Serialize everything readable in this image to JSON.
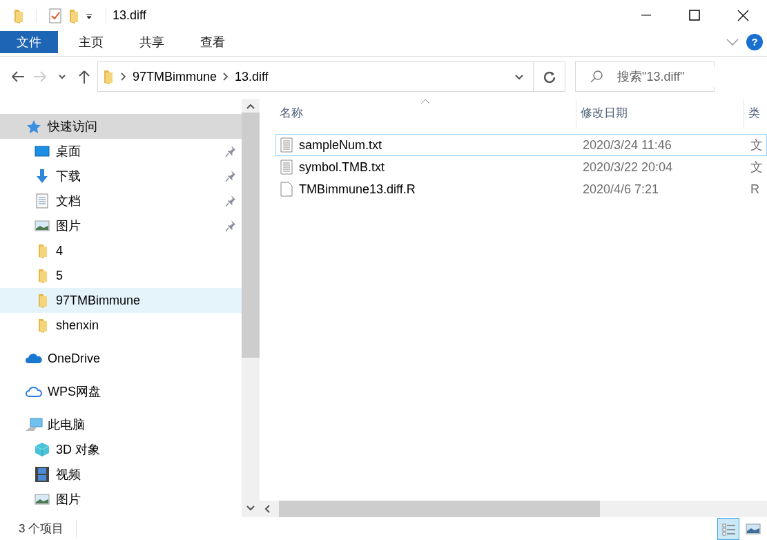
{
  "window": {
    "title": "13.diff"
  },
  "ribbon_tabs": [
    {
      "label": "文件",
      "selected": true
    },
    {
      "label": "主页",
      "selected": false
    },
    {
      "label": "共享",
      "selected": false
    },
    {
      "label": "查看",
      "selected": false
    }
  ],
  "help_button": {
    "label": "?"
  },
  "address_bar": {
    "path": [
      "97TMBimmune",
      "13.diff"
    ]
  },
  "search": {
    "placeholder": "搜索\"13.diff\""
  },
  "sidebar": {
    "items": [
      {
        "label": "快速访问",
        "kind": "star",
        "selected": false,
        "hovered": true,
        "pinned": false,
        "children": [
          {
            "label": "桌面",
            "kind": "desktop",
            "selected": false,
            "hovered": false,
            "pinned": true
          },
          {
            "label": "下载",
            "kind": "download",
            "selected": false,
            "hovered": false,
            "pinned": true
          },
          {
            "label": "文档",
            "kind": "document",
            "selected": false,
            "hovered": false,
            "pinned": true
          },
          {
            "label": "图片",
            "kind": "picture",
            "selected": false,
            "hovered": false,
            "pinned": true
          },
          {
            "label": "4",
            "kind": "folder",
            "selected": false,
            "hovered": false,
            "pinned": false
          },
          {
            "label": "5",
            "kind": "folder",
            "selected": false,
            "hovered": false,
            "pinned": false
          },
          {
            "label": "97TMBimmune",
            "kind": "folder",
            "selected": true,
            "hovered": false,
            "pinned": false
          },
          {
            "label": "shenxin",
            "kind": "folder",
            "selected": false,
            "hovered": false,
            "pinned": false
          }
        ]
      },
      {
        "label": "OneDrive",
        "kind": "onedrive",
        "selected": false,
        "hovered": false,
        "pinned": false
      },
      {
        "label": "WPS网盘",
        "kind": "cloud",
        "selected": false,
        "hovered": false,
        "pinned": false
      },
      {
        "label": "此电脑",
        "kind": "computer",
        "selected": false,
        "hovered": false,
        "pinned": false,
        "children": [
          {
            "label": "3D 对象",
            "kind": "cube",
            "selected": false,
            "hovered": false,
            "pinned": false
          },
          {
            "label": "视频",
            "kind": "video",
            "selected": false,
            "hovered": false,
            "pinned": false
          },
          {
            "label": "图片",
            "kind": "picture",
            "selected": false,
            "hovered": false,
            "pinned": false
          }
        ]
      }
    ]
  },
  "file_list": {
    "columns": [
      {
        "label": "名称",
        "sorted": true
      },
      {
        "label": "修改日期",
        "sorted": false
      },
      {
        "label": "类",
        "sorted": false
      }
    ],
    "rows": [
      {
        "name": "sampleNum.txt",
        "kind": "text",
        "modified": "2020/3/24 11:46",
        "column_3": "文",
        "focused": true
      },
      {
        "name": "symbol.TMB.txt",
        "kind": "text",
        "modified": "2020/3/22 20:04",
        "column_3": "文",
        "focused": false
      },
      {
        "name": "TMBimmune13.diff.R",
        "kind": "blank",
        "modified": "2020/4/6 7:21",
        "column_3": "R",
        "focused": false
      }
    ]
  },
  "status_bar": {
    "item_count": "3 个项目",
    "views": [
      {
        "kind": "details",
        "selected": true
      },
      {
        "kind": "thumbnails",
        "selected": false
      }
    ]
  }
}
